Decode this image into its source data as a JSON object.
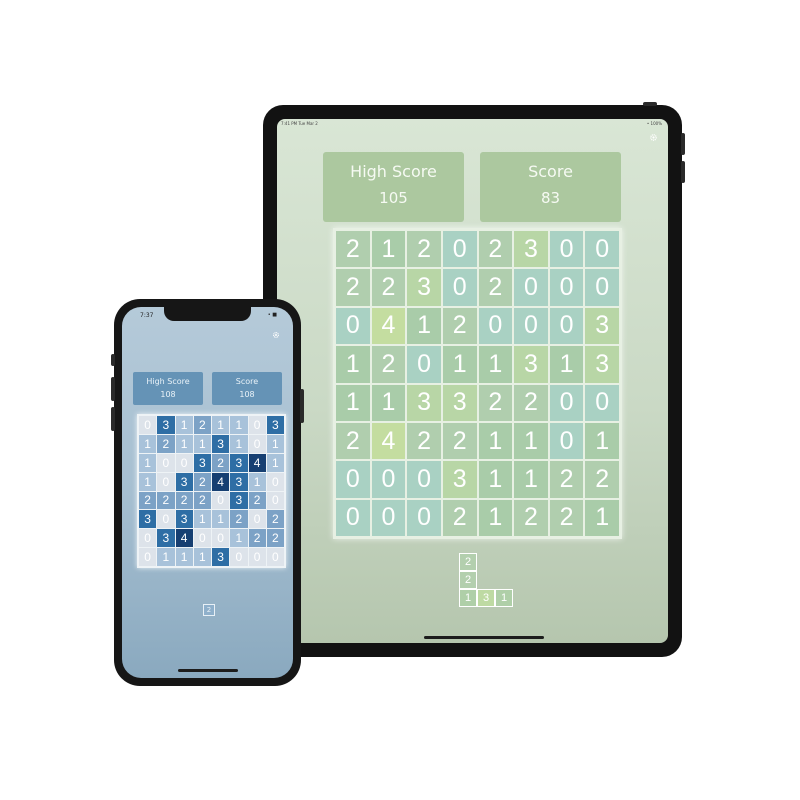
{
  "tablet": {
    "status_time": "7:41 PM  Tue Mar 2",
    "status_right": "• 100%",
    "gear_icon": "gear-icon",
    "high_score_label": "High Score",
    "high_score_value": "105",
    "score_label": "Score",
    "score_value": "83",
    "board": [
      [
        2,
        1,
        2,
        0,
        2,
        3,
        0,
        0
      ],
      [
        2,
        2,
        3,
        0,
        2,
        0,
        0,
        0
      ],
      [
        0,
        4,
        1,
        2,
        0,
        0,
        0,
        3
      ],
      [
        1,
        2,
        0,
        1,
        1,
        3,
        1,
        3
      ],
      [
        1,
        1,
        3,
        3,
        2,
        2,
        0,
        0
      ],
      [
        2,
        4,
        2,
        2,
        1,
        1,
        0,
        1
      ],
      [
        0,
        0,
        0,
        3,
        1,
        1,
        2,
        2
      ],
      [
        0,
        0,
        0,
        2,
        1,
        2,
        2,
        1
      ]
    ],
    "colors": {
      "0": "#a9d1c3",
      "1": "#a9cca9",
      "2": "#b0ceae",
      "3": "#b8d6a6",
      "4": "#c4dda0"
    },
    "next_piece": [
      "2",
      "2",
      "1",
      "3",
      "1"
    ]
  },
  "phone": {
    "status_time": "7:37",
    "status_right": "• ■",
    "gear_icon": "gear-icon",
    "high_score_label": "High Score",
    "high_score_value": "108",
    "score_label": "Score",
    "score_value": "108",
    "board": [
      [
        0,
        3,
        1,
        2,
        1,
        1,
        0,
        3
      ],
      [
        1,
        2,
        1,
        1,
        3,
        1,
        0,
        1
      ],
      [
        1,
        0,
        0,
        3,
        2,
        3,
        4,
        1
      ],
      [
        1,
        0,
        3,
        2,
        4,
        3,
        1,
        0
      ],
      [
        2,
        2,
        2,
        2,
        0,
        3,
        2,
        0
      ],
      [
        3,
        0,
        3,
        1,
        1,
        2,
        0,
        2
      ],
      [
        0,
        3,
        4,
        0,
        0,
        1,
        2,
        2
      ],
      [
        0,
        1,
        1,
        1,
        3,
        0,
        0,
        0
      ]
    ],
    "colors": {
      "0": "#dde3ea",
      "1": "#a8c2da",
      "2": "#7ca2c6",
      "3": "#2e6ea5",
      "4": "#163f72"
    },
    "next_piece": [
      "2"
    ]
  }
}
